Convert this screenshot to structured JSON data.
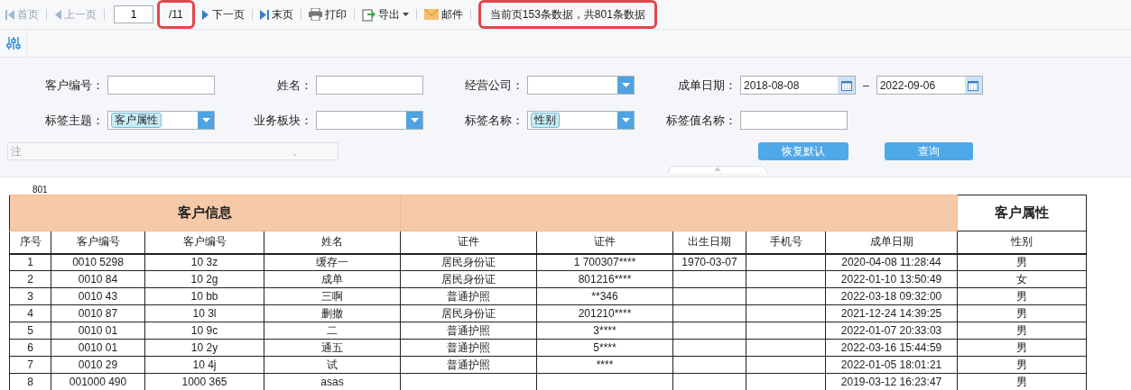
{
  "toolbar": {
    "items": [
      {
        "kind": "first",
        "label": "首页",
        "disabled": true
      },
      {
        "kind": "prev",
        "label": "上一页",
        "disabled": true
      },
      {
        "kind": "page",
        "value": "1",
        "total": "/11",
        "highlighted": true
      },
      {
        "kind": "next",
        "label": "下一页",
        "disabled": false
      },
      {
        "kind": "last",
        "label": "末页",
        "disabled": false
      },
      {
        "kind": "print",
        "label": "打印",
        "disabled": false
      },
      {
        "kind": "export",
        "label": "导出",
        "disabled": false
      },
      {
        "kind": "mail",
        "label": "邮件",
        "disabled": false
      }
    ],
    "status": {
      "text": "当前页153条数据，共801条数据",
      "highlighted": true
    }
  },
  "filters": {
    "fields": [
      {
        "kind": "input",
        "label": "客户编号："
      },
      {
        "kind": "input",
        "label": "姓名："
      },
      {
        "kind": "select",
        "label": "经营公司："
      },
      {
        "kind": "daterange",
        "label": "成单日期：",
        "from": "2018-08-08",
        "separator": "–",
        "to": "2022-09-06"
      },
      {
        "kind": "select",
        "label": "标签主题：",
        "tag": "客户属性"
      },
      {
        "kind": "select",
        "label": "业务板块："
      },
      {
        "kind": "select",
        "label": "标签名称：",
        "tag": "性别"
      },
      {
        "kind": "input",
        "label": "标签值名称："
      }
    ],
    "note": "注",
    "note_end": "。",
    "buttons": [
      "恢复默认",
      "查询"
    ]
  },
  "count": "801",
  "table": {
    "groups": [
      {
        "label": "客户信息",
        "kind": "orange"
      },
      {
        "kind": "orange"
      },
      {
        "label": "客户属性",
        "kind": "plain"
      }
    ],
    "columns": [
      "序号",
      "客户编号",
      "客户编号",
      "姓名",
      "证件",
      "证件",
      "出生日期",
      "手机号",
      "成单日期",
      "性别"
    ],
    "rows": [
      [
        "1",
        "0010 5298",
        "10 3z",
        "缓存一",
        "居民身份证",
        "1 700307****",
        "1970-03-07",
        "",
        "2020-04-08 11:28:44",
        "男"
      ],
      [
        "2",
        "0010 84",
        "10 2g",
        "成单",
        "居民身份证",
        "801216****",
        "",
        "",
        "2022-01-10 13:50:49",
        "女"
      ],
      [
        "3",
        "0010 43",
        "10 bb",
        "三啊",
        "普通护照",
        "**346",
        "",
        "",
        "2022-03-18 09:32:00",
        "男"
      ],
      [
        "4",
        "0010 87",
        "10 3l",
        "删撤",
        "居民身份证",
        "201210****",
        "",
        "",
        "2021-12-24 14:39:25",
        "男"
      ],
      [
        "5",
        "0010 01",
        "10 9c",
        "二",
        "普通护照",
        "3****",
        "",
        "",
        "2022-01-07 20:33:03",
        "男"
      ],
      [
        "6",
        "0010 01",
        "10 2y",
        "通五",
        "普通护照",
        "5****",
        "",
        "",
        "2022-03-16 15:44:59",
        "男"
      ],
      [
        "7",
        "0010 29",
        "10 4j",
        "试",
        "普通护照",
        "****",
        "",
        "",
        "2022-01-05 18:01:21",
        "男"
      ],
      [
        "8",
        "001000 490",
        "1000 365",
        "asas",
        "",
        "",
        "",
        "",
        "2019-03-12 16:23:47",
        "男"
      ]
    ]
  }
}
